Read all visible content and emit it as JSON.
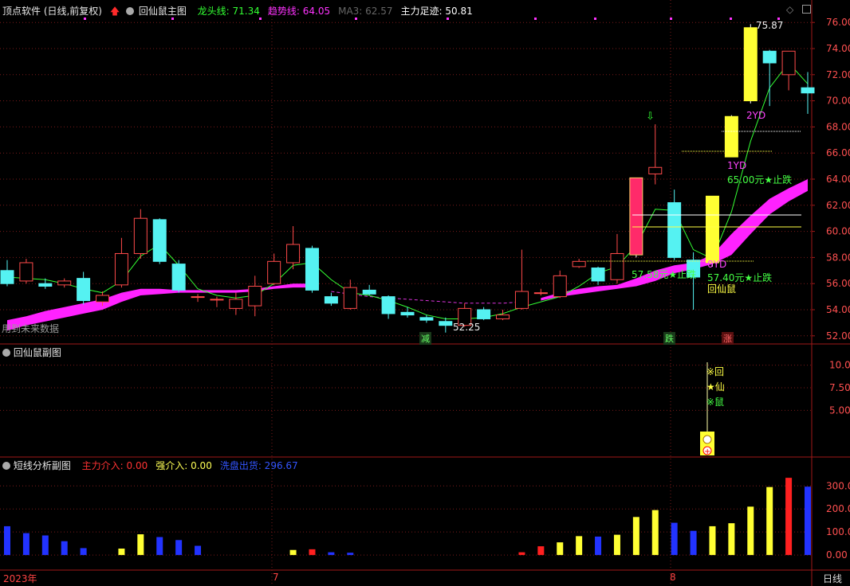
{
  "colors": {
    "up": "#ff4a4a",
    "down": "#55f2f2",
    "ma": "#33ff33",
    "band": "#ff22ff",
    "grid": "#7a1a1a",
    "yellow": "#ffff33",
    "blue": "#2233ff",
    "red": "#ff2020"
  },
  "main_panel": {
    "title": "顶点软件 (日线,前复权)",
    "indicator_name": "回仙鼠主图",
    "legend": [
      {
        "label": "龙头线: 71.34",
        "color": "#33ff33"
      },
      {
        "label": "趋势线: 64.05",
        "color": "#ff33ff"
      },
      {
        "label": "MA3: 62.57",
        "color": "#666666"
      },
      {
        "label": "主力足迹: 50.81",
        "color": "#ffffff"
      }
    ],
    "future_data_label": "用到未来数据",
    "high_label": "75.87",
    "low_label": "52.25",
    "annotations": {
      "yd2": "2YD",
      "yd1": "1YD",
      "stop1": "65.00元★止跌",
      "stop2": "57.58元★止跌",
      "yd0": "0YD",
      "stop3": "57.40元★止跌",
      "hxs": "回仙鼠"
    },
    "markers": {
      "m1": "减",
      "m2": "跌",
      "m3": "涨"
    },
    "y_ticks": [
      "76.00",
      "74.00",
      "72.00",
      "70.00",
      "68.00",
      "66.00",
      "64.00",
      "62.00",
      "60.00",
      "58.00",
      "56.00",
      "54.00",
      "52.00"
    ]
  },
  "sub1_panel": {
    "title": "回仙鼠副图",
    "y_ticks": [
      "10.00",
      "7.50",
      "5.00"
    ],
    "signal_text": [
      "※回",
      "★仙",
      "※鼠"
    ]
  },
  "sub2_panel": {
    "title": "短线分析副图",
    "legend": [
      {
        "label": "主力介入: 0.00",
        "color": "#ff3333"
      },
      {
        "label": "强介入: 0.00",
        "color": "#ffff55"
      },
      {
        "label": "洗盘出货: 296.67",
        "color": "#3355ff"
      }
    ],
    "y_ticks": [
      "300.0",
      "200.0",
      "100.0",
      "0.00"
    ]
  },
  "time_axis": {
    "labels": [
      "2023年",
      "7",
      "8"
    ],
    "period": "日线"
  },
  "chart_data": {
    "type": "candlestick",
    "y_range": [
      51.5,
      76.5
    ],
    "candles": [
      [
        57.0,
        56.0,
        57.8,
        55.8
      ],
      [
        56.2,
        57.6,
        57.9,
        56.0
      ],
      [
        56.0,
        55.8,
        56.4,
        55.6
      ],
      [
        55.9,
        56.2,
        56.4,
        55.7
      ],
      [
        56.4,
        54.7,
        56.9,
        54.4
      ],
      [
        54.6,
        55.1,
        55.4,
        54.3
      ],
      [
        55.9,
        58.3,
        59.5,
        55.7
      ],
      [
        58.3,
        61.0,
        61.7,
        57.9
      ],
      [
        60.9,
        57.7,
        61.0,
        57.5
      ],
      [
        57.5,
        55.5,
        57.8,
        55.3
      ],
      [
        55.0,
        55.0,
        55.2,
        54.6
      ],
      [
        54.8,
        54.8,
        55.0,
        54.2
      ],
      [
        54.1,
        54.8,
        55.3,
        53.6
      ],
      [
        54.3,
        55.8,
        56.6,
        53.5
      ],
      [
        56.0,
        57.7,
        58.3,
        55.9
      ],
      [
        57.6,
        59.0,
        60.4,
        57.1
      ],
      [
        58.7,
        55.5,
        58.9,
        55.3
      ],
      [
        55.0,
        54.5,
        55.3,
        54.3
      ],
      [
        54.1,
        55.7,
        56.3,
        54.0
      ],
      [
        55.5,
        55.2,
        55.9,
        55.1
      ],
      [
        55.0,
        53.7,
        55.1,
        53.3
      ],
      [
        53.8,
        53.6,
        54.2,
        53.4
      ],
      [
        53.4,
        53.2,
        53.6,
        53.0
      ],
      [
        53.1,
        52.8,
        53.4,
        52.25
      ],
      [
        52.8,
        54.1,
        54.5,
        52.7
      ],
      [
        54.0,
        53.3,
        54.2,
        53.2
      ],
      [
        53.3,
        53.6,
        54.0,
        53.2
      ],
      [
        54.1,
        55.4,
        58.6,
        54.0
      ],
      [
        55.3,
        55.3,
        55.6,
        55.1
      ],
      [
        55.0,
        56.6,
        57.0,
        54.9
      ],
      [
        57.3,
        57.7,
        57.9,
        57.2
      ],
      [
        57.2,
        56.2,
        57.3,
        55.9
      ],
      [
        56.3,
        58.3,
        59.8,
        56.0
      ],
      [
        58.2,
        64.1,
        64.1,
        58.0
      ],
      [
        64.4,
        64.9,
        68.2,
        63.6
      ],
      [
        62.2,
        58.0,
        63.2,
        57.8
      ],
      [
        57.8,
        56.5,
        58.4,
        54.0
      ],
      [
        57.6,
        62.7,
        62.7,
        57.3
      ],
      [
        65.7,
        68.8,
        68.9,
        65.7
      ],
      [
        70.0,
        75.6,
        75.87,
        69.8
      ],
      [
        73.8,
        72.9,
        73.9,
        69.6
      ],
      [
        72.0,
        73.8,
        73.8,
        70.8
      ],
      [
        71.0,
        70.6,
        72.2,
        69.0
      ]
    ],
    "candle_styles": {
      "33": "pink",
      "37": "yellow",
      "38": "yellow",
      "39": "yellow"
    },
    "ma_line": [
      56.5,
      56.4,
      56.3,
      56.0,
      55.6,
      55.3,
      56.2,
      58.1,
      59.0,
      57.4,
      55.6,
      55.1,
      54.9,
      55.1,
      56.0,
      57.4,
      57.6,
      56.3,
      55.3,
      55.1,
      54.7,
      54.2,
      53.6,
      53.3,
      53.3,
      53.4,
      53.7,
      54.2,
      54.6,
      55.0,
      55.8,
      56.8,
      57.3,
      58.9,
      61.7,
      61.6,
      58.6,
      57.9,
      61.5,
      66.9,
      71.0,
      72.9,
      71.3
    ],
    "band_upper": [
      53.2,
      53.5,
      53.9,
      54.2,
      54.5,
      54.8,
      55.3,
      55.6,
      55.6,
      55.5,
      55.5,
      55.5,
      55.5,
      55.6,
      55.8,
      56.0,
      56.0
    ],
    "band_lower": [
      52.4,
      52.8,
      53.1,
      53.4,
      53.7,
      54.0,
      54.6,
      55.1,
      55.2,
      55.3,
      55.3,
      55.3,
      55.3,
      55.4,
      55.6,
      55.7,
      55.7
    ],
    "band2_start": 28,
    "band2_upper": [
      54.9,
      55.3,
      55.6,
      55.8,
      55.9,
      56.4,
      57.0,
      57.4,
      57.6,
      58.2,
      59.8,
      61.2,
      62.5,
      63.3,
      64.0
    ],
    "band2_lower": [
      54.7,
      55.0,
      55.2,
      55.4,
      55.6,
      55.8,
      56.2,
      56.8,
      57.1,
      57.5,
      58.2,
      59.8,
      61.3,
      62.3,
      63.1
    ],
    "dash_line": [
      55.4,
      55.2,
      55.0,
      54.9,
      54.8,
      54.7,
      54.6,
      54.5,
      54.5,
      54.5,
      54.6
    ],
    "sub2_bars": [
      [
        0,
        125,
        "blue"
      ],
      [
        1,
        95,
        "blue"
      ],
      [
        2,
        85,
        "blue"
      ],
      [
        3,
        60,
        "blue"
      ],
      [
        4,
        30,
        "blue"
      ],
      [
        6,
        28,
        "yellow"
      ],
      [
        7,
        90,
        "yellow"
      ],
      [
        8,
        78,
        "blue"
      ],
      [
        9,
        65,
        "blue"
      ],
      [
        10,
        40,
        "blue"
      ],
      [
        15,
        22,
        "yellow"
      ],
      [
        16,
        25,
        "red"
      ],
      [
        17,
        12,
        "blue"
      ],
      [
        18,
        10,
        "blue"
      ],
      [
        27,
        12,
        "red"
      ],
      [
        28,
        38,
        "red"
      ],
      [
        29,
        55,
        "yellow"
      ],
      [
        30,
        82,
        "yellow"
      ],
      [
        31,
        80,
        "blue"
      ],
      [
        32,
        88,
        "yellow"
      ],
      [
        33,
        165,
        "yellow"
      ],
      [
        34,
        195,
        "yellow"
      ],
      [
        35,
        140,
        "blue"
      ],
      [
        36,
        105,
        "blue"
      ],
      [
        37,
        125,
        "yellow"
      ],
      [
        38,
        138,
        "yellow"
      ],
      [
        39,
        210,
        "yellow"
      ],
      [
        40,
        295,
        "yellow"
      ],
      [
        41,
        335,
        "red"
      ],
      [
        42,
        296.67,
        "blue"
      ]
    ],
    "sub2_range": [
      -10,
      370
    ],
    "sub1_range": [
      0,
      12
    ]
  }
}
